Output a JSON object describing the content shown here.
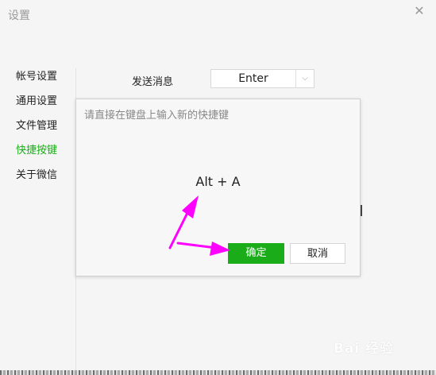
{
  "window": {
    "title": "设置",
    "close_icon": "close-icon"
  },
  "sidebar": {
    "items": [
      {
        "label": "帐号设置",
        "active": false
      },
      {
        "label": "通用设置",
        "active": false
      },
      {
        "label": "文件管理",
        "active": false
      },
      {
        "label": "快捷按键",
        "active": true
      },
      {
        "label": "关于微信",
        "active": false
      }
    ]
  },
  "main": {
    "send_message": {
      "label": "发送消息",
      "value": "Enter"
    }
  },
  "dialog": {
    "hint": "请直接在键盘上输入新的快捷键",
    "shortcut": "Alt  +  A",
    "ok_label": "确定",
    "cancel_label": "取消"
  },
  "watermark": "Bai 经验",
  "colors": {
    "accent": "#1aad19",
    "annotation": "#ff00ff"
  }
}
